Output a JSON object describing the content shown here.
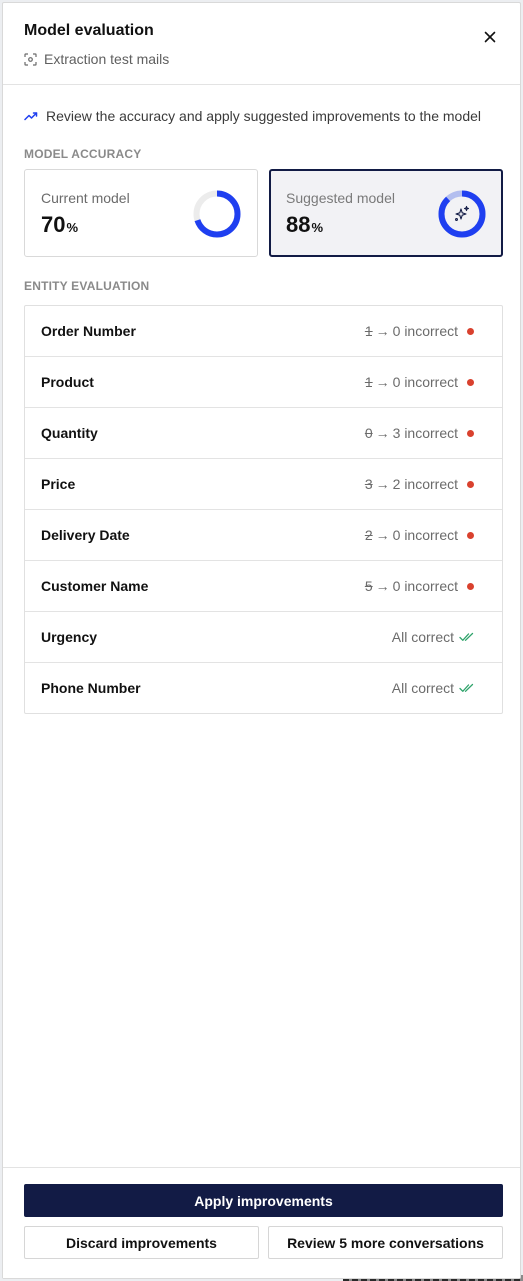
{
  "header": {
    "title": "Model evaluation",
    "subtitle": "Extraction test mails",
    "subtitle_icon": "scan-icon",
    "close_icon": "close-icon"
  },
  "info_text": "Review the accuracy and apply suggested improvements to the model",
  "accuracy": {
    "section_label": "MODEL ACCURACY",
    "current": {
      "label": "Current model",
      "value": "70",
      "unit": "%",
      "fraction": 0.7
    },
    "suggested": {
      "label": "Suggested model",
      "value": "88",
      "unit": "%",
      "fraction": 0.88,
      "icon": "sparkle-icon"
    }
  },
  "entities": {
    "section_label": "ENTITY EVALUATION",
    "items": [
      {
        "name": "Order Number",
        "old": "1",
        "arrow": "→",
        "status": "0 incorrect",
        "correct": false
      },
      {
        "name": "Product",
        "old": "1",
        "arrow": "→",
        "status": "0 incorrect",
        "correct": false
      },
      {
        "name": "Quantity",
        "old": "0",
        "arrow": "→",
        "status": "3 incorrect",
        "correct": false
      },
      {
        "name": "Price",
        "old": "3",
        "arrow": "→",
        "status": "2 incorrect",
        "correct": false
      },
      {
        "name": "Delivery Date",
        "old": "2",
        "arrow": "→",
        "status": "0 incorrect",
        "correct": false
      },
      {
        "name": "Customer Name",
        "old": "5",
        "arrow": "→",
        "status": "0 incorrect",
        "correct": false
      },
      {
        "name": "Urgency",
        "status": "All correct",
        "correct": true
      },
      {
        "name": "Phone Number",
        "status": "All correct",
        "correct": true
      }
    ]
  },
  "footer": {
    "apply_label": "Apply improvements",
    "discard_label": "Discard improvements",
    "review_label": "Review 5 more conversations"
  },
  "colors": {
    "accent_blue": "#1f3ff0",
    "navy": "#121b45",
    "error_dot": "#d9412e",
    "success_check": "#2fa36b"
  }
}
